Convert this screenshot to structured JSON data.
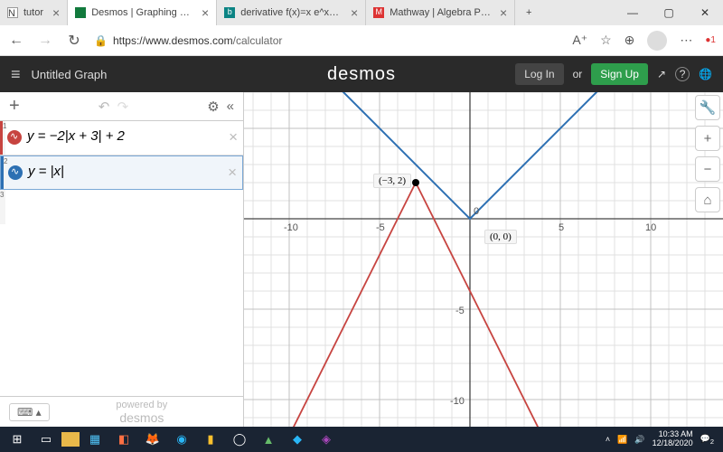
{
  "tabs": {
    "t0": {
      "label": "tutor"
    },
    "t1": {
      "label": "Desmos | Graphing Calculator"
    },
    "t2": {
      "label": "derivative f(x)=x e^x - Bing"
    },
    "t3": {
      "label": "Mathway | Algebra Problem S"
    }
  },
  "url": {
    "host": "https://www.desmos.com",
    "path": "/calculator"
  },
  "header": {
    "title": "Untitled Graph",
    "logo": "desmos",
    "login": "Log In",
    "or": "or",
    "signup": "Sign Up"
  },
  "expressions": {
    "e1": {
      "num": "1",
      "text": "y = −2|x + 3| + 2"
    },
    "e2": {
      "num": "2",
      "text": "y = |x|"
    },
    "e3": {
      "num": "3"
    }
  },
  "sidefoot": {
    "powered": "powered by",
    "brand": "desmos"
  },
  "graph": {
    "points": {
      "p1": "(−3, 2)",
      "p2": "(0, 0)"
    },
    "ticks": {
      "xn10": "-10",
      "xn5": "-5",
      "x5": "5",
      "x10": "10",
      "yn5": "-5",
      "yn10": "-10"
    }
  },
  "taskbar": {
    "time": "10:33 AM",
    "date": "12/18/2020",
    "notif": "2"
  },
  "chart_data": {
    "type": "line",
    "title": "",
    "xlabel": "",
    "ylabel": "",
    "xlim": [
      -13,
      13
    ],
    "ylim": [
      -13,
      5
    ],
    "series": [
      {
        "name": "y = -2|x+3| + 2",
        "color": "#c74440",
        "points": [
          [
            -10,
            -12
          ],
          [
            -3,
            2
          ],
          [
            4,
            -12
          ]
        ]
      },
      {
        "name": "y = |x|",
        "color": "#2d70b3",
        "points": [
          [
            -5,
            5
          ],
          [
            0,
            0
          ],
          [
            5,
            5
          ]
        ]
      }
    ],
    "markers": [
      {
        "x": -3,
        "y": 2,
        "label": "(-3,2)"
      },
      {
        "x": 0,
        "y": 0,
        "label": "(0,0)"
      }
    ]
  }
}
